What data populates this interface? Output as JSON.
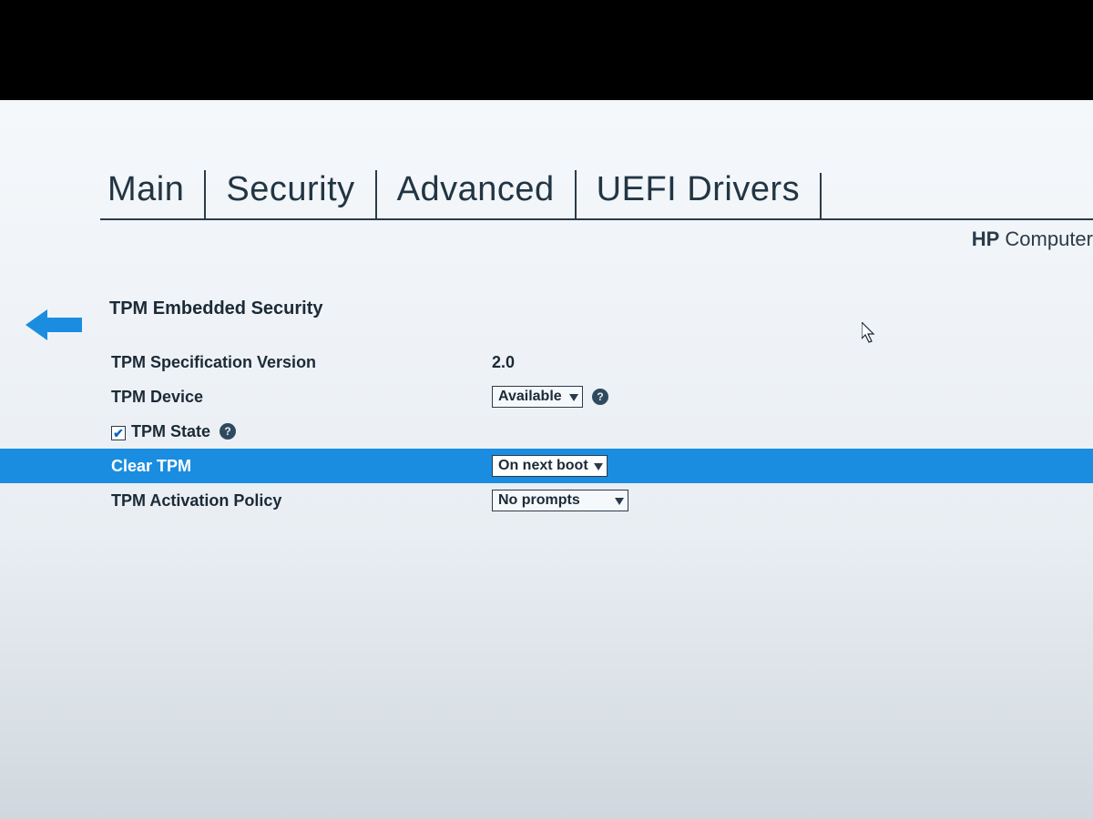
{
  "brand_prefix": "HP",
  "brand_rest": " Computer",
  "tabs": {
    "main": "Main",
    "security": "Security",
    "advanced": "Advanced",
    "uefi": "UEFI Drivers"
  },
  "page_title": "TPM Embedded Security",
  "rows": {
    "spec_version": {
      "label": "TPM Specification Version",
      "value": "2.0"
    },
    "device": {
      "label": "TPM Device",
      "value": "Available"
    },
    "state": {
      "label": "TPM State"
    },
    "clear": {
      "label": "Clear TPM",
      "value": "On next boot"
    },
    "activation": {
      "label": "TPM Activation Policy",
      "value": "No prompts"
    }
  },
  "tpm_state_checked": true,
  "help_glyph": "?"
}
